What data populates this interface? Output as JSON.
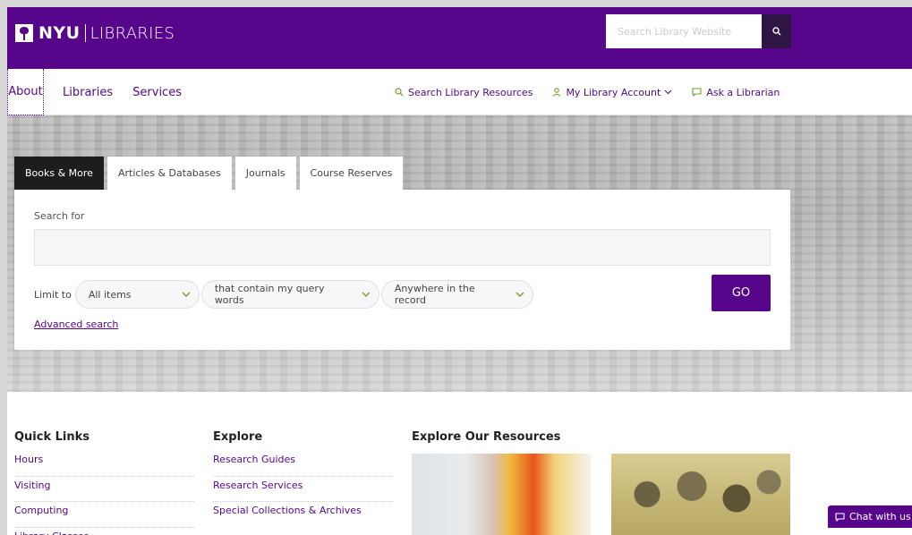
{
  "header": {
    "logo_nyu": "NYU",
    "logo_libraries": "LIBRARIES",
    "search_placeholder": "Search Library Website",
    "search_icon": "search-icon",
    "brand_color": "#57068c"
  },
  "nav": {
    "items": [
      {
        "label": "About"
      },
      {
        "label": "Libraries"
      },
      {
        "label": "Services"
      }
    ],
    "utilities": [
      {
        "label": "Search Library Resources",
        "icon": "search-icon"
      },
      {
        "label": "My Library Account",
        "icon": "user-icon"
      },
      {
        "label": "Ask a Librarian",
        "icon": "chat-bubble-icon"
      }
    ]
  },
  "search": {
    "tabs": [
      {
        "label": "Books & More",
        "active": true
      },
      {
        "label": "Articles & Databases",
        "active": false
      },
      {
        "label": "Journals",
        "active": false
      },
      {
        "label": "Course Reserves",
        "active": false
      }
    ],
    "label": "Search for",
    "query": "",
    "limit_label": "Limit to",
    "limit_items": "All items",
    "contain": "that contain my query words",
    "scope": "Anywhere in the record",
    "go": "GO",
    "advanced": "Advanced search"
  },
  "footer": {
    "quick_links": {
      "title": "Quick Links",
      "links": [
        "Hours",
        "Visiting",
        "Computing",
        "Library Classes"
      ]
    },
    "explore": {
      "title": "Explore",
      "links": [
        "Research Guides",
        "Research Services",
        "Special Collections & Archives"
      ]
    },
    "resources": {
      "title": "Explore Our Resources"
    }
  },
  "chat": {
    "label": "Chat with us"
  }
}
